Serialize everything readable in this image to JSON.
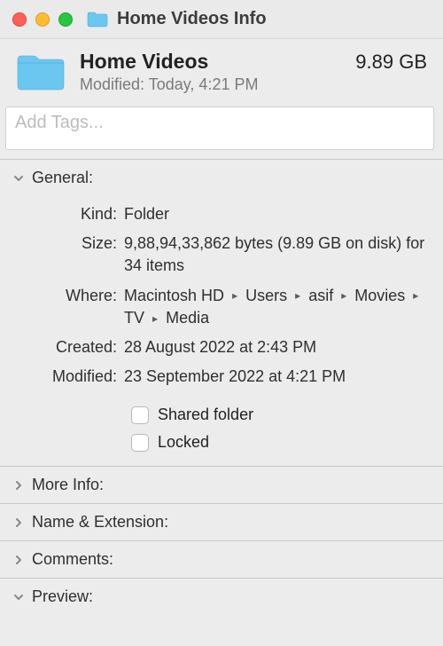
{
  "window": {
    "title": "Home Videos Info"
  },
  "header": {
    "name": "Home Videos",
    "size": "9.89 GB",
    "modified_label": "Modified:",
    "modified_value": "Today, 4:21 PM"
  },
  "tags": {
    "placeholder": "Add Tags..."
  },
  "sections": {
    "general": {
      "title": "General:",
      "kind_label": "Kind:",
      "kind_value": "Folder",
      "size_label": "Size:",
      "size_value": "9,88,94,33,862 bytes (9.89 GB on disk) for 34 items",
      "where_label": "Where:",
      "where_parts": [
        "Macintosh HD",
        "Users",
        "asif",
        "Movies",
        "TV",
        "Media"
      ],
      "created_label": "Created:",
      "created_value": "28 August 2022 at 2:43 PM",
      "modified_label": "Modified:",
      "modified_value": "23 September 2022 at 4:21 PM",
      "shared_folder_label": "Shared folder",
      "locked_label": "Locked"
    },
    "more_info": {
      "title": "More Info:"
    },
    "name_ext": {
      "title": "Name & Extension:"
    },
    "comments": {
      "title": "Comments:"
    },
    "preview": {
      "title": "Preview:"
    }
  }
}
